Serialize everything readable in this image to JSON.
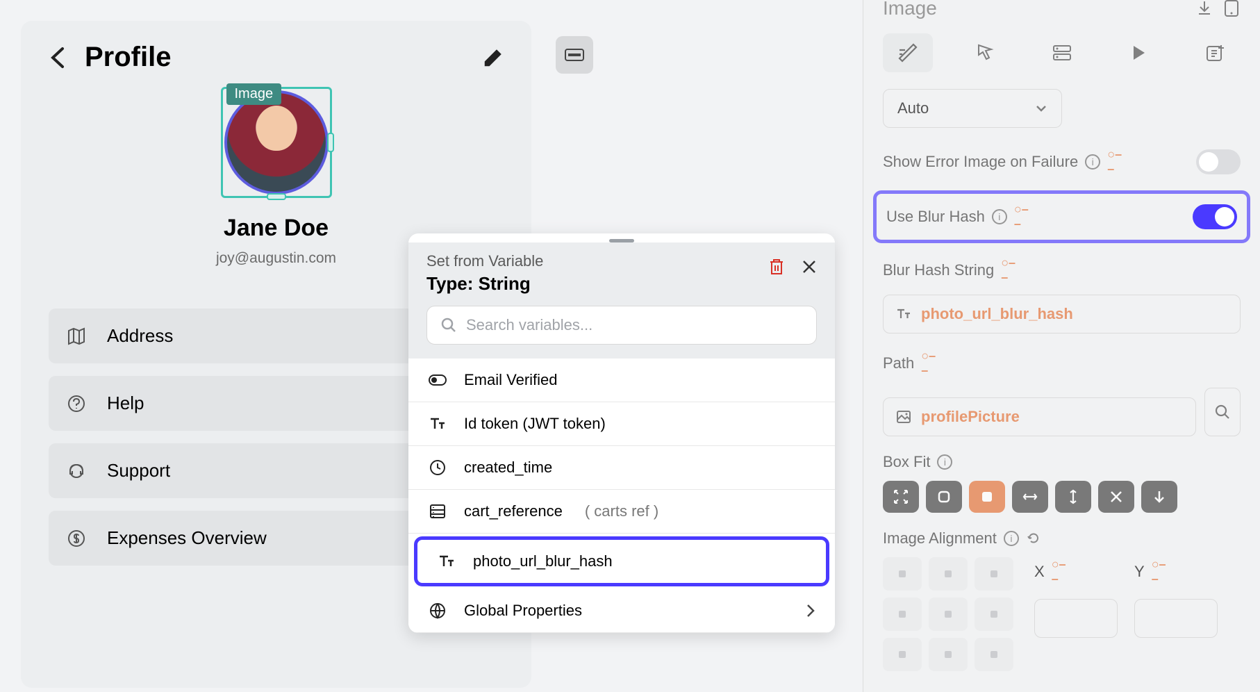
{
  "canvas": {
    "title": "Profile",
    "selection_tag": "Image",
    "profile_name": "Jane Doe",
    "profile_email": "joy@augustin.com",
    "menu": [
      {
        "icon": "map",
        "label": "Address"
      },
      {
        "icon": "help",
        "label": "Help"
      },
      {
        "icon": "support",
        "label": "Support"
      },
      {
        "icon": "dollar",
        "label": "Expenses Overview"
      }
    ]
  },
  "popup": {
    "subtitle": "Set from Variable",
    "title": "Type: String",
    "search_placeholder": "Search variables...",
    "items": [
      {
        "icon": "toggle",
        "label": "Email Verified",
        "ref": ""
      },
      {
        "icon": "text",
        "label": "Id token (JWT token)",
        "ref": ""
      },
      {
        "icon": "clock",
        "label": "created_time",
        "ref": ""
      },
      {
        "icon": "db",
        "label": "cart_reference",
        "ref": "( carts ref )"
      },
      {
        "icon": "text",
        "label": "photo_url_blur_hash",
        "ref": "",
        "highlighted": true
      },
      {
        "icon": "globe",
        "label": "Global Properties",
        "ref": "",
        "chevron": true
      }
    ]
  },
  "panel": {
    "component": "Image",
    "dropdown": "Auto",
    "error_image_label": "Show Error Image on Failure",
    "blur_hash_label": "Use Blur Hash",
    "blur_hash_string_label": "Blur Hash String",
    "blur_hash_value": "photo_url_blur_hash",
    "path_label": "Path",
    "path_value": "profilePicture",
    "box_fit_label": "Box Fit",
    "alignment_label": "Image Alignment",
    "x_label": "X",
    "y_label": "Y"
  }
}
